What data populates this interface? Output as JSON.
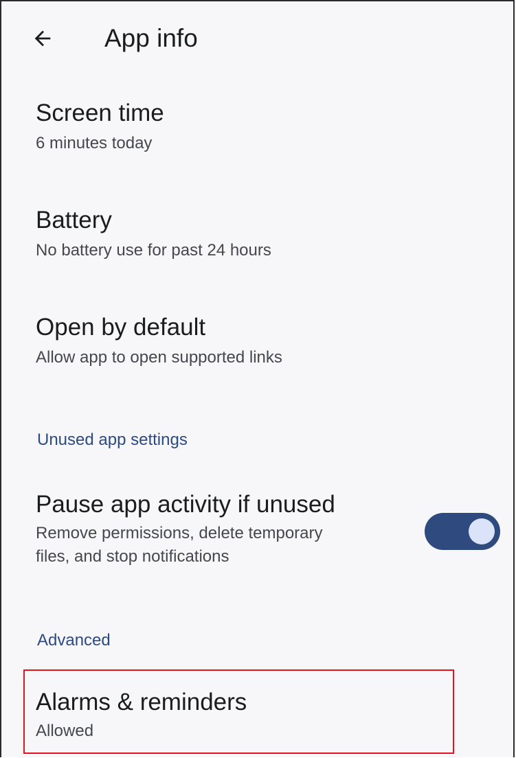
{
  "header": {
    "title": "App info",
    "back_icon": "arrow-back-icon"
  },
  "items": {
    "screen_time": {
      "title": "Screen time",
      "summary": "6 minutes today"
    },
    "battery": {
      "title": "Battery",
      "summary": "No battery use for past 24 hours"
    },
    "open_by_default": {
      "title": "Open by default",
      "summary": "Allow app to open supported links"
    },
    "pause_app": {
      "title": "Pause app activity if unused",
      "summary_line1": "Remove permissions, delete temporary",
      "summary_line2": "files, and stop notifications",
      "toggle_on": true
    },
    "alarms": {
      "title": "Alarms & reminders",
      "summary": "Allowed"
    }
  },
  "categories": {
    "unused": "Unused app settings",
    "advanced": "Advanced"
  },
  "colors": {
    "background": "#f7f7fa",
    "accent": "#2f4a7e",
    "category_text": "#2c4a82",
    "highlight_border": "#e3131e"
  }
}
